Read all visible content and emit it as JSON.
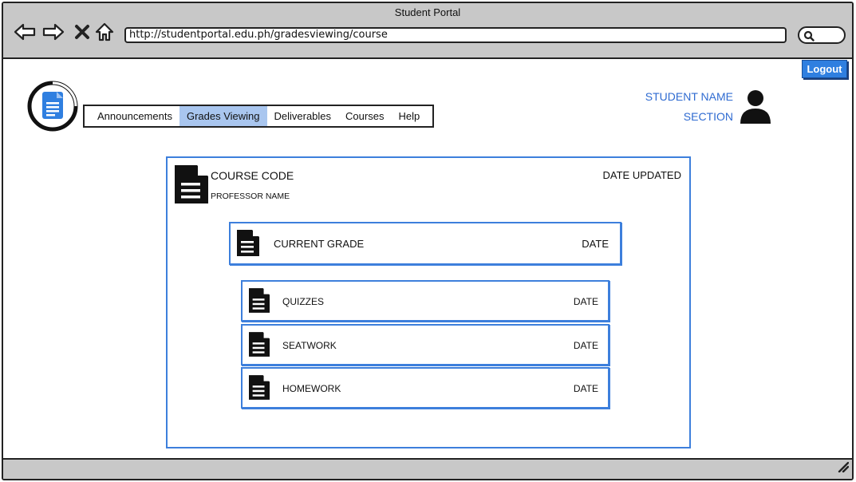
{
  "window": {
    "title": "Student Portal",
    "url": "http://studentportal.edu.ph/gradesviewing/course"
  },
  "header": {
    "logout_label": "Logout",
    "student_name": "STUDENT NAME",
    "section": "SECTION"
  },
  "menu": {
    "items": [
      {
        "label": "Announcements",
        "active": false
      },
      {
        "label": "Grades Viewing",
        "active": true
      },
      {
        "label": "Deliverables",
        "active": false
      },
      {
        "label": "Courses",
        "active": false
      },
      {
        "label": "Help",
        "active": false
      }
    ]
  },
  "course": {
    "code": "COURSE CODE",
    "professor": "PROFESSOR NAME",
    "date_updated": "DATE UPDATED",
    "current_grade": {
      "label": "CURRENT GRADE",
      "date": "DATE"
    },
    "components": [
      {
        "label": "QUIZZES",
        "date": "DATE"
      },
      {
        "label": "SEATWORK",
        "date": "DATE"
      },
      {
        "label": "HOMEWORK",
        "date": "DATE"
      }
    ]
  },
  "colors": {
    "accent_blue": "#2f7fe0",
    "border_blue": "#3d7fdc",
    "active_tab": "#a9c6ef",
    "chrome_gray": "#c8c8c8"
  },
  "icons": [
    "back-arrow-icon",
    "forward-arrow-icon",
    "close-icon",
    "home-icon",
    "search-icon",
    "document-icon",
    "user-icon",
    "resize-grip-icon"
  ]
}
